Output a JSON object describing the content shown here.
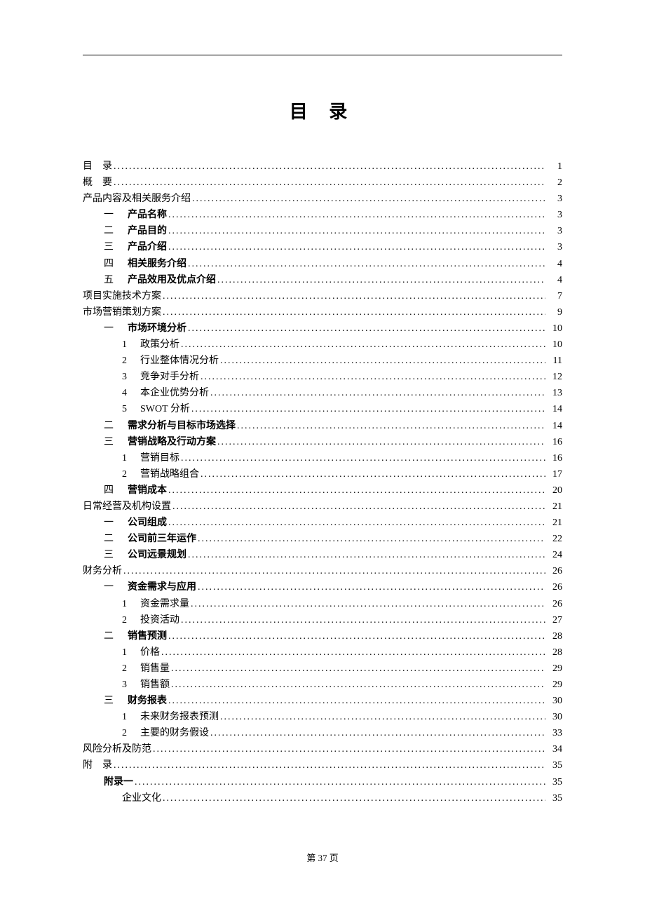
{
  "title": "目 录",
  "footer": "第 37 页",
  "toc": [
    {
      "level": 0,
      "num": "",
      "label": "目　录",
      "page": "1",
      "bold": false,
      "spaced": false
    },
    {
      "level": 0,
      "num": "",
      "label": "概　要",
      "page": "2",
      "bold": false,
      "spaced": false
    },
    {
      "level": 0,
      "num": "",
      "label": "产品内容及相关服务介绍",
      "page": "3",
      "bold": false
    },
    {
      "level": 1,
      "num": "一",
      "label": "产品名称",
      "page": "3",
      "bold": true
    },
    {
      "level": 1,
      "num": "二",
      "label": "产品目的",
      "page": "3",
      "bold": true
    },
    {
      "level": 1,
      "num": "三",
      "label": "产品介绍",
      "page": "3",
      "bold": true
    },
    {
      "level": 1,
      "num": "四",
      "label": "相关服务介绍",
      "page": "4",
      "bold": true
    },
    {
      "level": 1,
      "num": "五",
      "label": "产品效用及优点介绍",
      "page": "4",
      "bold": true
    },
    {
      "level": 0,
      "num": "",
      "label": "项目实施技术方案",
      "page": "7",
      "bold": false
    },
    {
      "level": 0,
      "num": "",
      "label": "市场营销策划方案",
      "page": "9",
      "bold": false
    },
    {
      "level": 1,
      "num": "一",
      "label": "市场环境分析",
      "page": "10",
      "bold": true
    },
    {
      "level": 2,
      "num": "1",
      "label": "政策分析",
      "page": "10",
      "bold": false
    },
    {
      "level": 2,
      "num": "2",
      "label": "行业整体情况分析",
      "page": "11",
      "bold": false
    },
    {
      "level": 2,
      "num": "3",
      "label": "竞争对手分析",
      "page": "12",
      "bold": false
    },
    {
      "level": 2,
      "num": "4",
      "label": "本企业优势分析",
      "page": "13",
      "bold": false
    },
    {
      "level": 2,
      "num": "5",
      "label": "SWOT 分析",
      "page": "14",
      "bold": false
    },
    {
      "level": 1,
      "num": "二",
      "label": "需求分析与目标市场选择",
      "page": "14",
      "bold": true
    },
    {
      "level": 1,
      "num": "三",
      "label": "营销战略及行动方案",
      "page": "16",
      "bold": true
    },
    {
      "level": 2,
      "num": "1",
      "label": "营销目标",
      "page": "16",
      "bold": false
    },
    {
      "level": 2,
      "num": "2",
      "label": "营销战略组合",
      "page": "17",
      "bold": false
    },
    {
      "level": 1,
      "num": "四",
      "label": "营销成本",
      "page": "20",
      "bold": true
    },
    {
      "level": 0,
      "num": "",
      "label": "日常经营及机构设置",
      "page": "21",
      "bold": false
    },
    {
      "level": 1,
      "num": "一",
      "label": "公司组成",
      "page": "21",
      "bold": true
    },
    {
      "level": 1,
      "num": "二",
      "label": "公司前三年运作",
      "page": "22",
      "bold": true
    },
    {
      "level": 1,
      "num": "三",
      "label": "公司远景规划",
      "page": "24",
      "bold": true
    },
    {
      "level": 0,
      "num": "",
      "label": "财务分析",
      "page": "26",
      "bold": false
    },
    {
      "level": 1,
      "num": "一",
      "label": "资金需求与应用",
      "page": "26",
      "bold": true
    },
    {
      "level": 2,
      "num": "1",
      "label": "资金需求量",
      "page": "26",
      "bold": false
    },
    {
      "level": 2,
      "num": "2",
      "label": "投资活动",
      "page": "27",
      "bold": false
    },
    {
      "level": 1,
      "num": "二",
      "label": "销售预测",
      "page": "28",
      "bold": true
    },
    {
      "level": 2,
      "num": "1",
      "label": "价格",
      "page": "28",
      "bold": false
    },
    {
      "level": 2,
      "num": "2",
      "label": "销售量",
      "page": "29",
      "bold": false
    },
    {
      "level": 2,
      "num": "3",
      "label": "销售额",
      "page": "29",
      "bold": false
    },
    {
      "level": 1,
      "num": "三",
      "label": "财务报表",
      "page": "30",
      "bold": true
    },
    {
      "level": 2,
      "num": "1",
      "label": "未来财务报表预测",
      "page": "30",
      "bold": false
    },
    {
      "level": 2,
      "num": "2",
      "label": "主要的财务假设",
      "page": "33",
      "bold": false
    },
    {
      "level": 0,
      "num": "",
      "label": "风险分析及防范",
      "page": "34",
      "bold": false
    },
    {
      "level": 0,
      "num": "",
      "label": "附　录",
      "page": "35",
      "bold": false,
      "spaced": false
    },
    {
      "level": 1,
      "num": "",
      "label": "附录一",
      "page": "35",
      "bold": true
    },
    {
      "level": 2,
      "num": "",
      "label": "企业文化",
      "page": "35",
      "bold": false
    }
  ]
}
